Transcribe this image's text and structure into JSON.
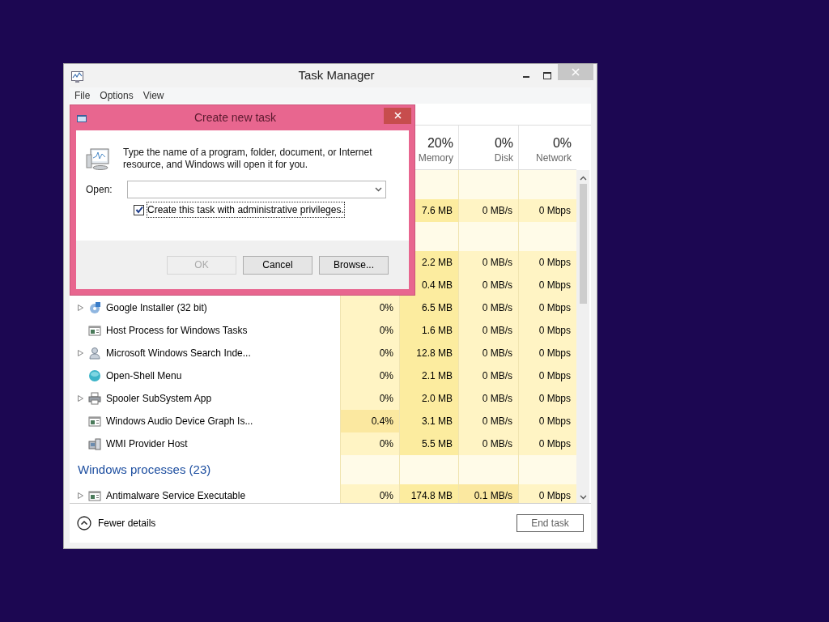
{
  "window": {
    "title": "Task Manager"
  },
  "menu": [
    "File",
    "Options",
    "View"
  ],
  "table": {
    "columns": [
      {
        "percent": "20%",
        "label": "Memory"
      },
      {
        "percent": "0%",
        "label": "Disk"
      },
      {
        "percent": "0%",
        "label": "Network"
      }
    ],
    "rows": [
      {
        "kind": "group"
      },
      {
        "kind": "process",
        "memory": "7.6 MB",
        "disk": "0 MB/s",
        "network": "0 Mbps"
      },
      {
        "kind": "group"
      },
      {
        "kind": "process",
        "memory": "2.2 MB",
        "disk": "0 MB/s",
        "network": "0 Mbps"
      },
      {
        "kind": "process",
        "memory": "0.4 MB",
        "disk": "0 MB/s",
        "network": "0 Mbps"
      },
      {
        "kind": "process",
        "name": "Google Installer (32 bit)",
        "expandable": true,
        "cpu": "0%",
        "cpu_high": false,
        "memory": "6.5 MB",
        "disk": "0 MB/s",
        "disk_high": false,
        "network": "0 Mbps"
      },
      {
        "kind": "process",
        "name": "Host Process for Windows Tasks",
        "expandable": false,
        "cpu": "0%",
        "cpu_high": false,
        "memory": "1.6 MB",
        "disk": "0 MB/s",
        "disk_high": false,
        "network": "0 Mbps"
      },
      {
        "kind": "process",
        "name": "Microsoft Windows Search Inde...",
        "expandable": true,
        "cpu": "0%",
        "cpu_high": false,
        "memory": "12.8 MB",
        "disk": "0 MB/s",
        "disk_high": false,
        "network": "0 Mbps"
      },
      {
        "kind": "process",
        "name": "Open-Shell Menu",
        "expandable": false,
        "cpu": "0%",
        "cpu_high": false,
        "memory": "2.1 MB",
        "disk": "0 MB/s",
        "disk_high": false,
        "network": "0 Mbps"
      },
      {
        "kind": "process",
        "name": "Spooler SubSystem App",
        "expandable": true,
        "cpu": "0%",
        "cpu_high": false,
        "memory": "2.0 MB",
        "disk": "0 MB/s",
        "disk_high": false,
        "network": "0 Mbps"
      },
      {
        "kind": "process",
        "name": "Windows Audio Device Graph Is...",
        "expandable": false,
        "cpu": "0.4%",
        "cpu_high": true,
        "memory": "3.1 MB",
        "disk": "0 MB/s",
        "disk_high": false,
        "network": "0 Mbps"
      },
      {
        "kind": "process",
        "name": "WMI Provider Host",
        "expandable": false,
        "cpu": "0%",
        "cpu_high": false,
        "memory": "5.5 MB",
        "disk": "0 MB/s",
        "disk_high": false,
        "network": "0 Mbps"
      },
      {
        "kind": "group",
        "label": "Windows processes (23)"
      },
      {
        "kind": "process",
        "name": "Antimalware Service Executable",
        "expandable": true,
        "cpu": "0%",
        "cpu_high": false,
        "memory": "174.8 MB",
        "disk": "0.1 MB/s",
        "disk_high": true,
        "network": "0 Mbps"
      }
    ]
  },
  "footer": {
    "toggle": "Fewer details",
    "end_task": {
      "label": "End task",
      "disabled": true
    }
  },
  "dialog": {
    "title": "Create new task",
    "message": "Type the name of a program, folder, document, or Internet resource, and Windows will open it for you.",
    "open_label": "Open:",
    "checkbox": {
      "label": "Create this task with administrative privileges.",
      "checked": true
    },
    "buttons": [
      {
        "label": "OK",
        "disabled": true
      },
      {
        "label": "Cancel",
        "disabled": false
      },
      {
        "label": "Browse...",
        "disabled": false
      }
    ]
  }
}
